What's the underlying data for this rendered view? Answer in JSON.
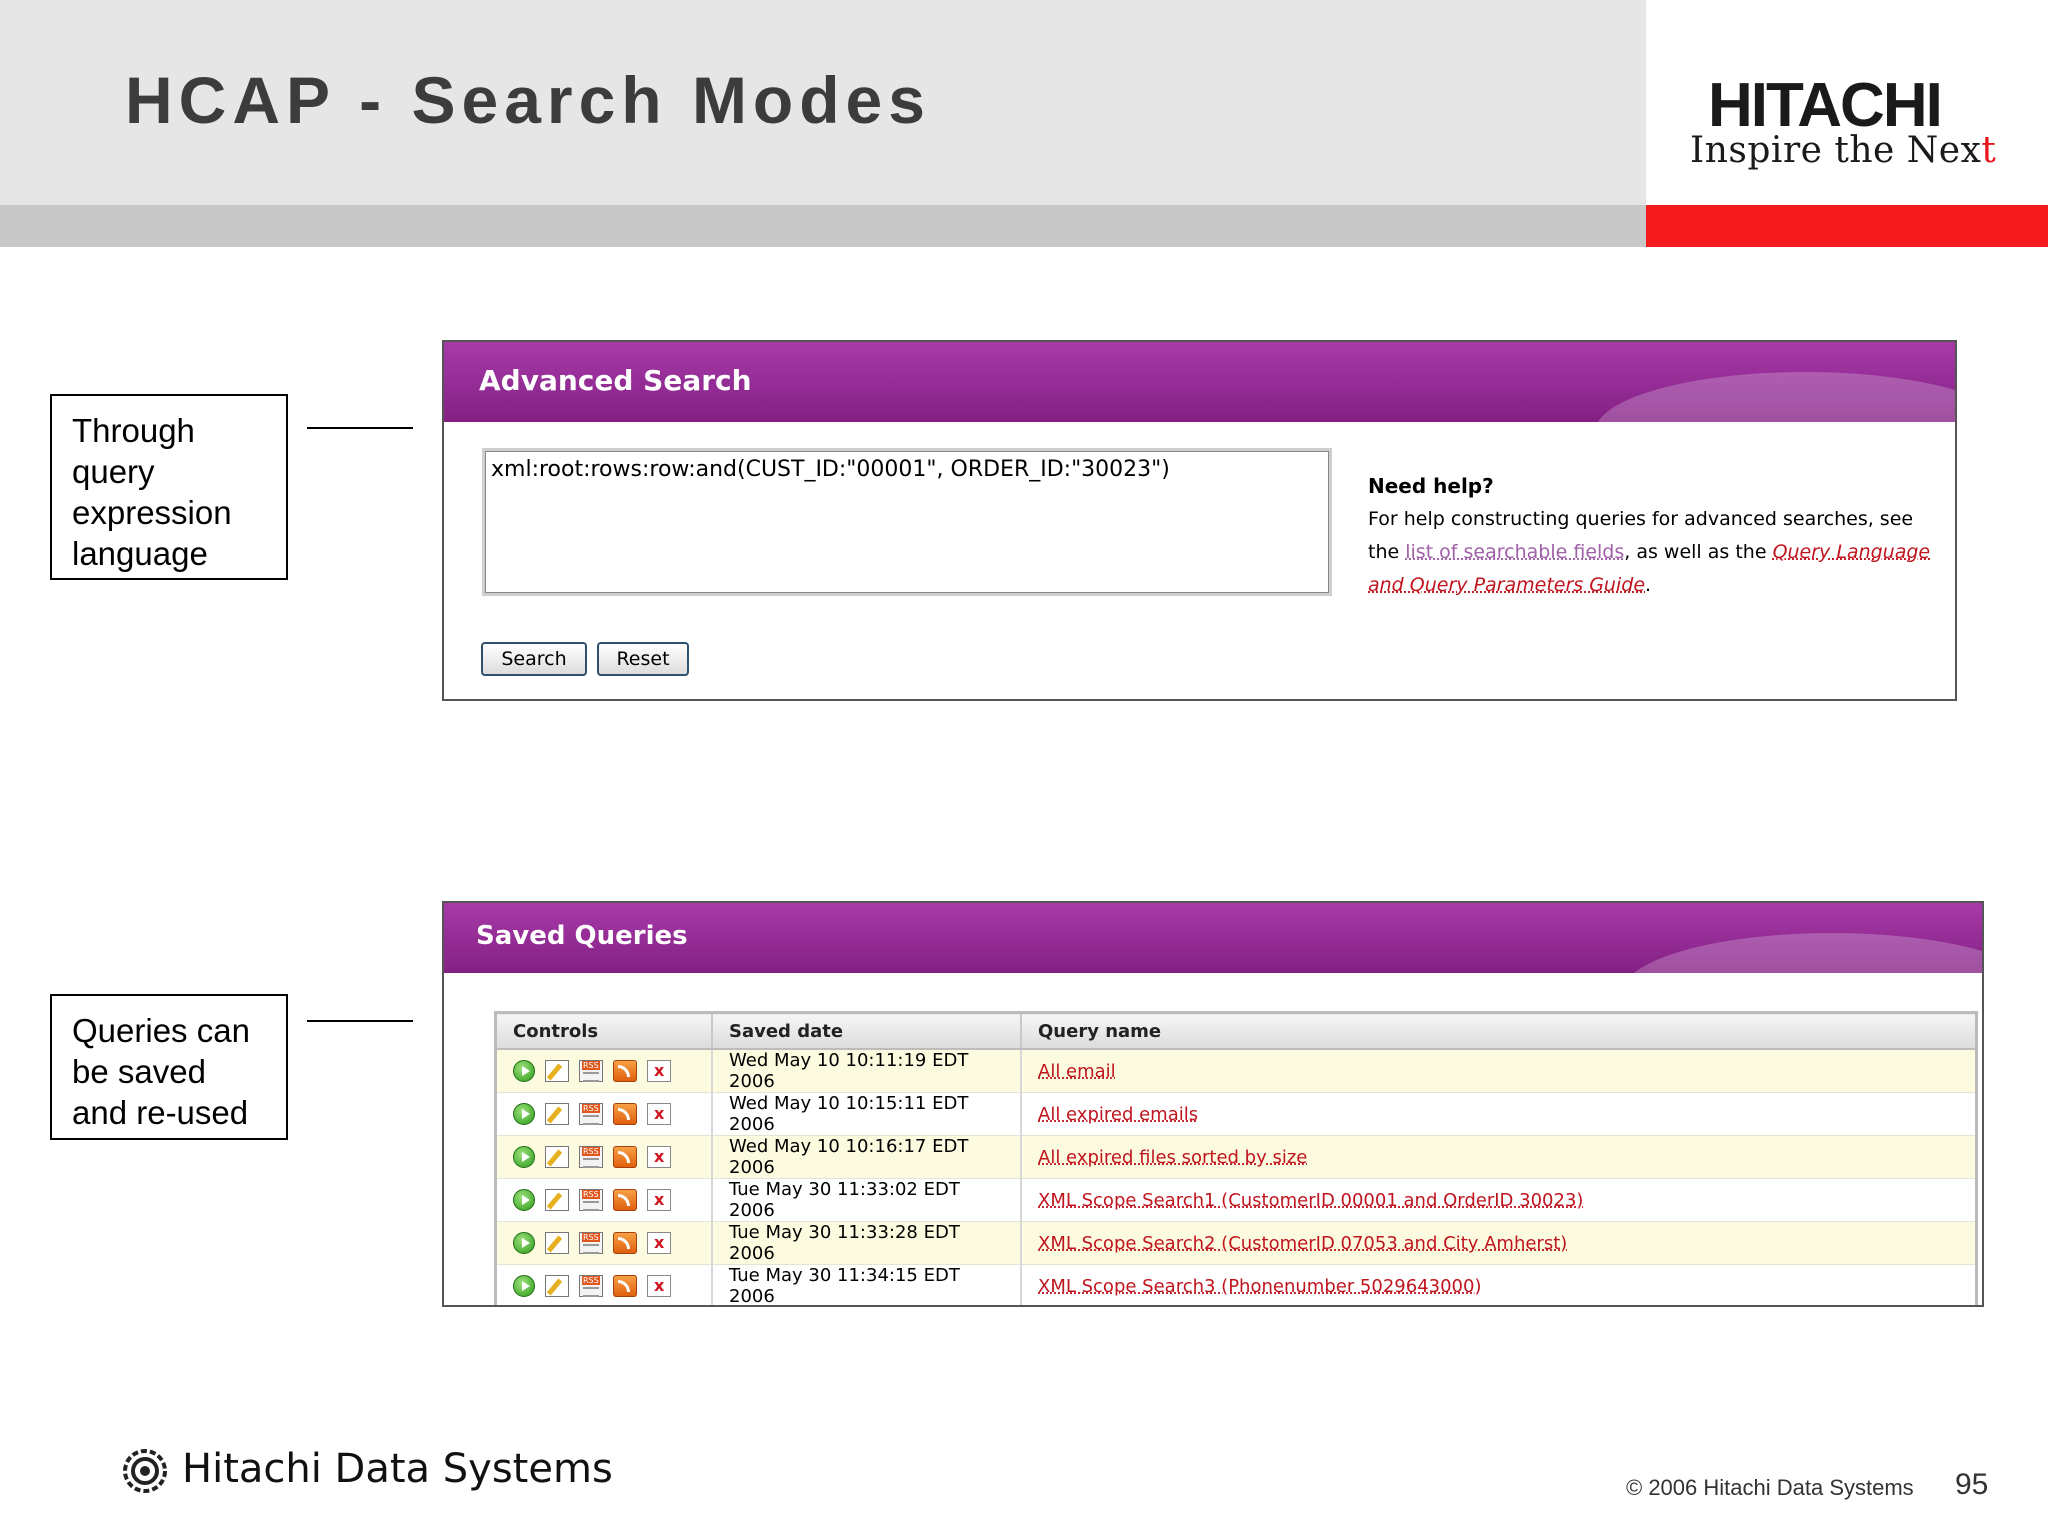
{
  "slide": {
    "title": "HCAP - Search Modes",
    "logo": {
      "brand": "HITACHI",
      "tagline_main": "Inspire the Nex",
      "tagline_end": "t"
    },
    "page_number": "95",
    "copyright": "© 2006 Hitachi Data Systems",
    "footer_brand": "Hitachi Data Systems",
    "colors": {
      "accent_red": "#f41a1e",
      "panel_purple": "#932c95",
      "link_red": "#c0141e"
    }
  },
  "callouts": [
    {
      "text": "Through\nquery\nexpression\nlanguage"
    },
    {
      "text": "Queries can\nbe saved\nand re-used"
    }
  ],
  "advanced_search": {
    "title": "Advanced Search",
    "query_value": "xml:root:rows:row:and(CUST_ID:\"00001\", ORDER_ID:\"30023\")",
    "search_label": "Search",
    "reset_label": "Reset",
    "help": {
      "title": "Need help?",
      "text_1": "For help constructing queries for advanced searches, see the ",
      "link_fields": "list of searchable fields",
      "text_2": ", as well as the ",
      "link_guide": "Query Language and Query Parameters Guide",
      "text_3": "."
    }
  },
  "saved_queries": {
    "title": "Saved Queries",
    "columns": [
      "Controls",
      "Saved date",
      "Query name"
    ],
    "control_icons": [
      "run-icon",
      "edit-icon",
      "rss-page-icon",
      "rss-feed-icon",
      "delete-icon"
    ],
    "rows": [
      {
        "date": "Wed May 10 10:11:19 EDT 2006",
        "name": "All email"
      },
      {
        "date": "Wed May 10 10:15:11 EDT 2006",
        "name": "All expired emails"
      },
      {
        "date": "Wed May 10 10:16:17 EDT 2006",
        "name": "All expired files sorted by size"
      },
      {
        "date": "Tue May 30 11:33:02 EDT 2006",
        "name": "XML Scope Search1 (CustomerID 00001 and OrderID 30023)"
      },
      {
        "date": "Tue May 30 11:33:28 EDT 2006",
        "name": "XML Scope Search2 (CustomerID 07053 and City Amherst)"
      },
      {
        "date": "Tue May 30 11:34:15 EDT 2006",
        "name": "XML Scope Search3 (Phonenumber 5029643000)"
      }
    ]
  }
}
